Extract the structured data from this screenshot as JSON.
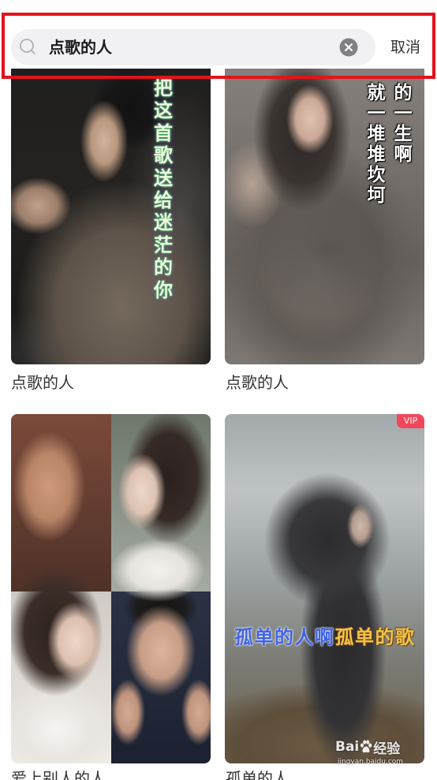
{
  "search": {
    "query": "点歌的人",
    "cancel_label": "取消",
    "search_icon": "search-icon",
    "clear_icon": "clear-icon"
  },
  "results": [
    {
      "title": "点歌的人",
      "lyrics": [
        "把这首歌送给迷茫的你"
      ]
    },
    {
      "title": "点歌的人",
      "lyrics": [
        "就一堆堆坎坷",
        "的一生啊"
      ]
    },
    {
      "title": "爱上别人的人"
    },
    {
      "title": "孤单的人",
      "badge": "VIP",
      "lyrics": [
        "孤单的人啊",
        "孤单的歌"
      ]
    }
  ],
  "watermark": {
    "brand_prefix": "Bai",
    "brand_suffix": "经验",
    "url": "jingyan.baidu.com",
    "icon": "paw-icon"
  },
  "colors": {
    "annotation": "#e3121b",
    "vip_badge": "#f2465c",
    "search_field": "#f1f1f3",
    "clear_icon": "#808080"
  }
}
